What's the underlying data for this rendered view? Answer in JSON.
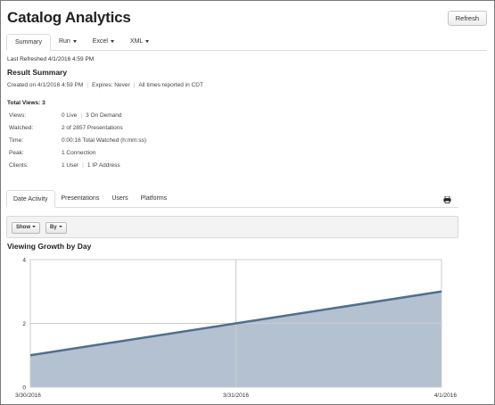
{
  "app": {
    "title": "Catalog Analytics",
    "refresh_label": "Refresh"
  },
  "top_tabs": [
    {
      "label": "Summary",
      "active": true,
      "dropdown": false
    },
    {
      "label": "Run",
      "active": false,
      "dropdown": true
    },
    {
      "label": "Excel",
      "active": false,
      "dropdown": true
    },
    {
      "label": "XML",
      "active": false,
      "dropdown": true
    }
  ],
  "last_refreshed": "Last Refreshed 4/1/2016 4:59 PM",
  "summary": {
    "title": "Result Summary",
    "created": "Created on 4/1/2016 4:59 PM",
    "expires": "Expires: Never",
    "timezone": "All times reported in CDT"
  },
  "total_views": "Total Views: 3",
  "stats": [
    {
      "label": "Views:",
      "value": "0 Live",
      "value2": "3 On Demand"
    },
    {
      "label": "Watched:",
      "value": "2 of 2857 Presentations",
      "value2": ""
    },
    {
      "label": "Time:",
      "value": "0:00:16 Total Watched (h:mm:ss)",
      "value2": ""
    },
    {
      "label": "Peak:",
      "value": "1 Connection",
      "value2": ""
    },
    {
      "label": "Clients:",
      "value": "1 User",
      "value2": "1 IP Address"
    }
  ],
  "sub_tabs": [
    {
      "label": "Date Activity",
      "active": true
    },
    {
      "label": "Presentations",
      "active": false
    },
    {
      "label": "Users",
      "active": false
    },
    {
      "label": "Platforms",
      "active": false
    }
  ],
  "print_icon": "printer-icon",
  "filters": {
    "show_label": "Show",
    "by_label": "By"
  },
  "chart_title": "Viewing Growth by Day",
  "colors": {
    "area_fill": "#b4c1d1",
    "line": "#4f6f8f",
    "grid": "#cccccc"
  },
  "chart_data": {
    "type": "area",
    "title": "Viewing Growth by Day",
    "x": [
      "3/30/2016",
      "3/31/2016",
      "4/1/2016"
    ],
    "series": [
      {
        "values": [
          1,
          2,
          3
        ]
      }
    ],
    "ylim": [
      0,
      4
    ],
    "yticks": [
      0,
      2,
      4
    ],
    "grid": true,
    "legend": "none"
  }
}
